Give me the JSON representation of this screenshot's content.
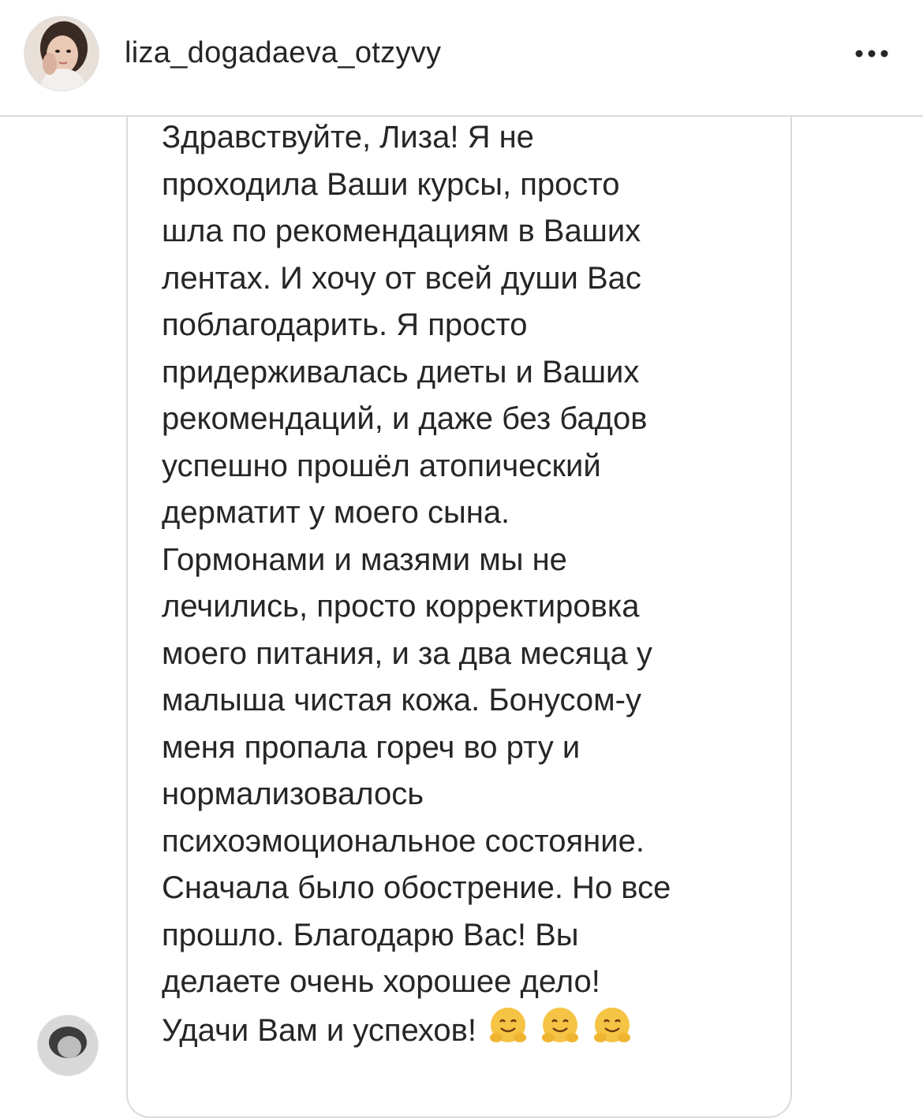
{
  "header": {
    "username": "liza_dogadaeva_otzyvy"
  },
  "message": {
    "text": "Здравствуйте, Лиза! Я не\nпроходила Ваши курсы, просто\nшла по рекомендациям в Ваших\nлентах. И хочу от всей души Вас\nпоблагодарить. Я просто\nпридерживалась диеты и Ваших\nрекомендаций, и даже без бадов\nуспешно прошёл атопический\nдерматит у моего сына.\nГормонами и мазями мы не\nлечились, просто корректировка\nмоего питания, и за два месяца у\nмалыша чистая кожа. Бонусом-у\nменя пропала гореч во рту и\nнормализовалось\nпсихоэмоциональное состояние.\nСначала было обострение. Но все\nпрошло. Благодарю Вас! Вы\nделаете очень хорошее дело!\nУдачи Вам и успехов!",
    "emojis": [
      "hugging-face-emoji",
      "hugging-face-emoji",
      "hugging-face-emoji"
    ]
  },
  "icons": {
    "more": "more-options-icon",
    "profile": "profile-avatar",
    "commenter": "commenter-avatar"
  },
  "colors": {
    "text": "#262626",
    "border": "#dbdbdb",
    "emoji": "#f6c445"
  }
}
